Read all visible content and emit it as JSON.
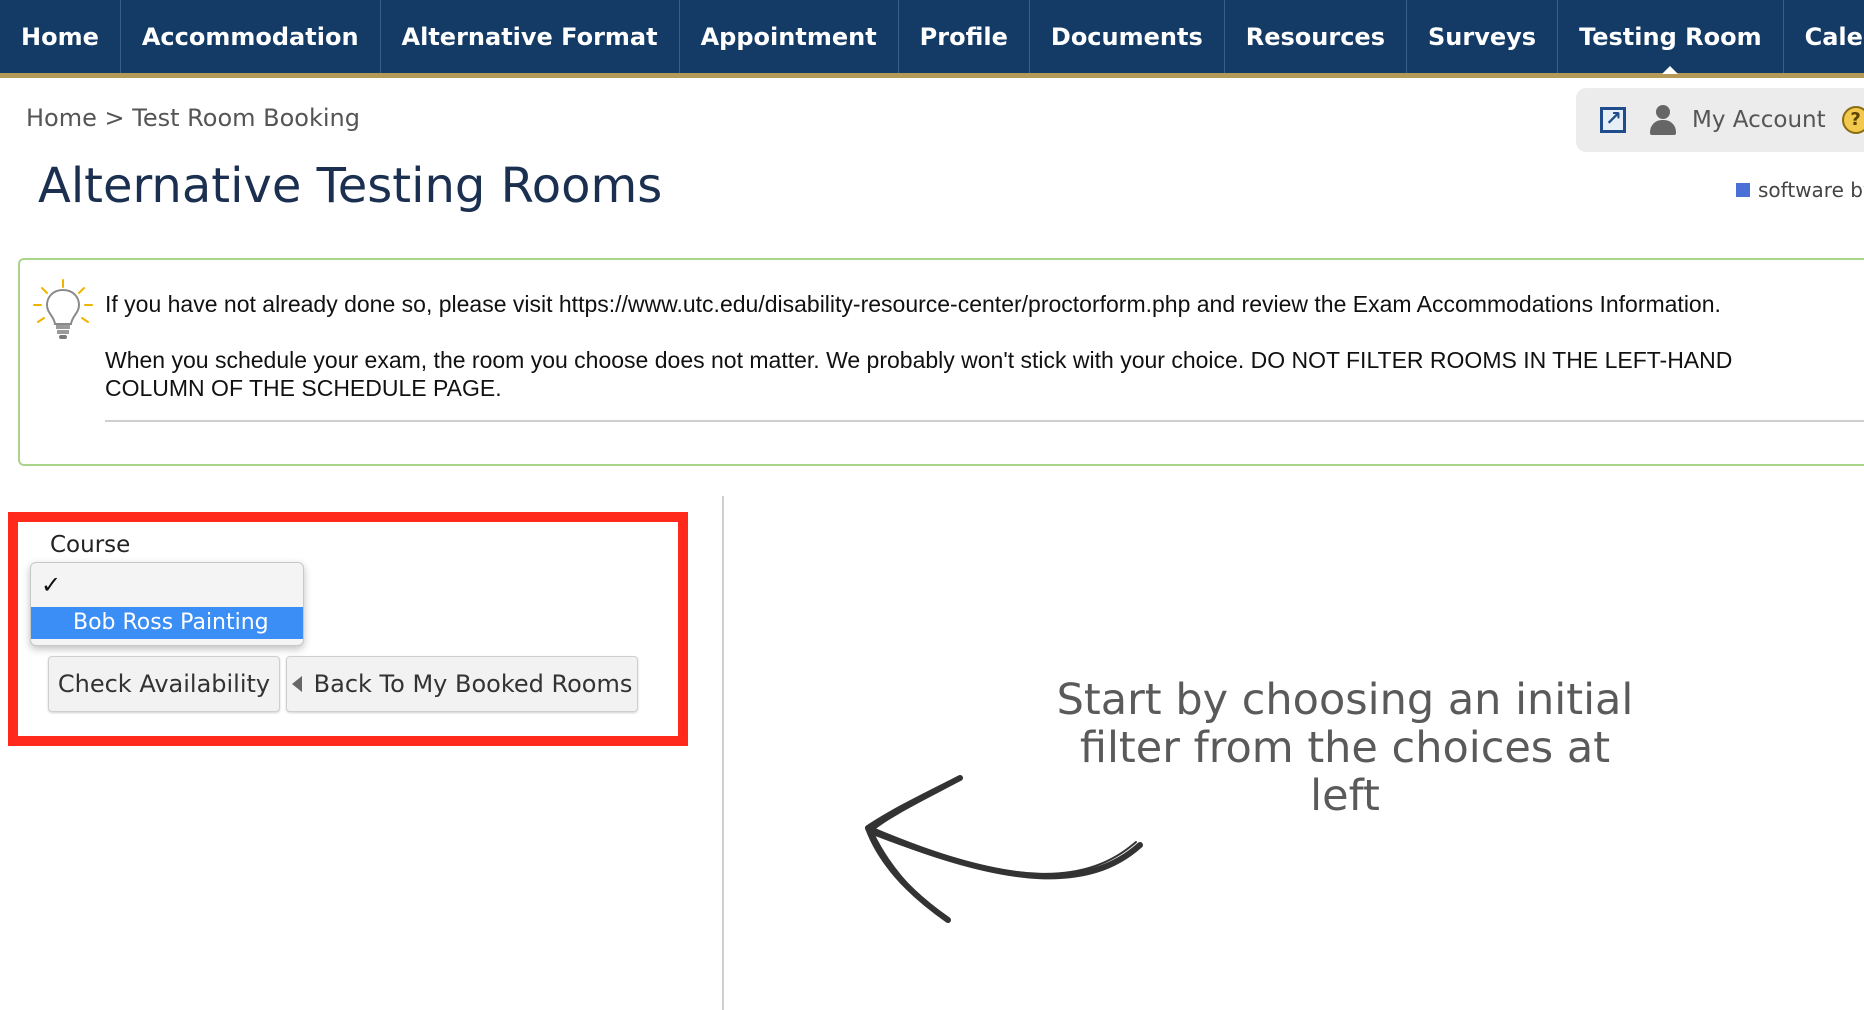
{
  "nav": {
    "items": [
      {
        "label": "Home",
        "active": false
      },
      {
        "label": "Accommodation",
        "active": false
      },
      {
        "label": "Alternative Format",
        "active": false
      },
      {
        "label": "Appointment",
        "active": false
      },
      {
        "label": "Profile",
        "active": false
      },
      {
        "label": "Documents",
        "active": false
      },
      {
        "label": "Resources",
        "active": false
      },
      {
        "label": "Surveys",
        "active": false
      },
      {
        "label": "Testing Room",
        "active": true
      },
      {
        "label": "Calendar",
        "active": false
      }
    ]
  },
  "breadcrumb": {
    "home": "Home",
    "separator": ">",
    "current": "Test Room Booking"
  },
  "account": {
    "label": "My Account",
    "help_glyph": "?"
  },
  "page": {
    "title": "Alternative Testing Rooms",
    "software_by": "software by"
  },
  "notice": {
    "line1": "If you have not already done so, please visit https://www.utc.edu/disability-resource-center/proctorform.php and review the Exam Accommodations Information.",
    "line2": "When you schedule your exam, the room you choose does not matter. We probably won't stick with your choice. DO NOT FILTER ROOMS IN THE LEFT-HAND COLUMN OF THE SCHEDULE PAGE."
  },
  "filter": {
    "course_label": "Course",
    "selected_check": "✓",
    "option_label": "Bob Ross Painting",
    "check_availability": "Check Availability",
    "back_to_booked": "Back To My Booked Rooms"
  },
  "hint": {
    "line1": "Start by choosing an initial",
    "line2": "filter from the choices at left"
  },
  "colors": {
    "nav_bg": "#143b66",
    "nav_border": "#b59a57",
    "highlight": "#ff2a1c",
    "selected_option": "#3a8ef5"
  }
}
